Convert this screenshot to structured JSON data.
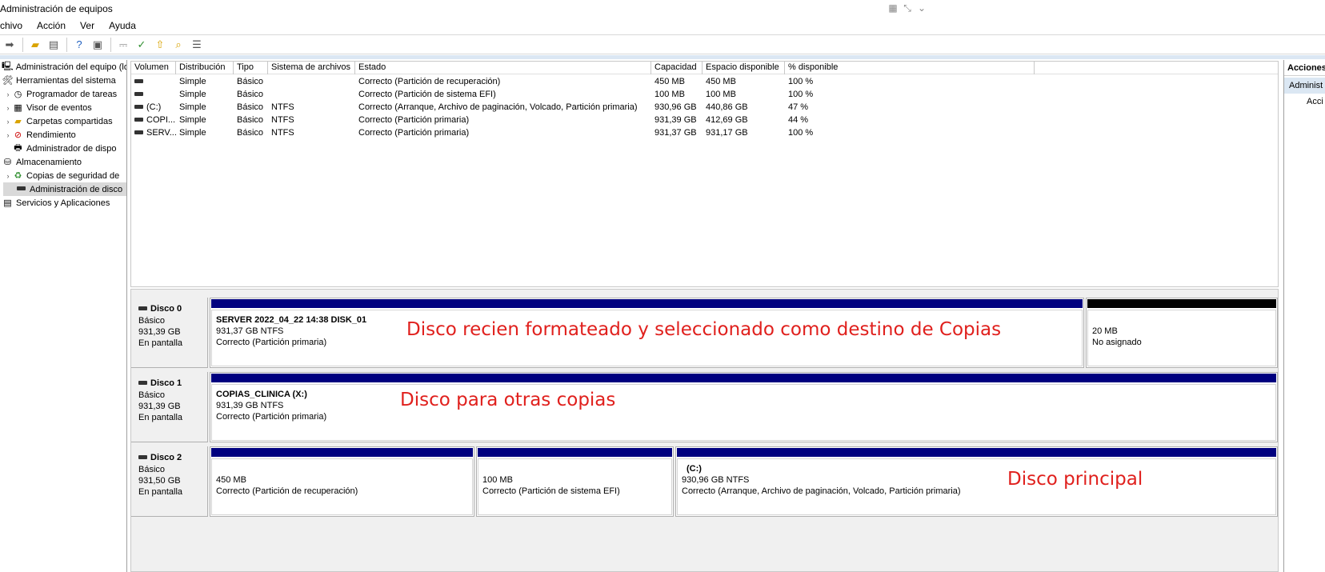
{
  "window": {
    "title": "Administración de equipos"
  },
  "menu": [
    "chivo",
    "Acción",
    "Ver",
    "Ayuda"
  ],
  "tree": [
    {
      "label": "Administración del equipo (loc",
      "level": 0,
      "icon": "computer-icon",
      "chevron": false
    },
    {
      "label": "Herramientas del sistema",
      "level": 0,
      "icon": "tools-icon",
      "chevron": false
    },
    {
      "label": "Programador de tareas",
      "level": 1,
      "icon": "clock-icon",
      "chevron": true
    },
    {
      "label": "Visor de eventos",
      "level": 1,
      "icon": "event-viewer-icon",
      "chevron": true
    },
    {
      "label": "Carpetas compartidas",
      "level": 1,
      "icon": "shared-folder-icon",
      "chevron": true
    },
    {
      "label": "Rendimiento",
      "level": 1,
      "icon": "performance-icon",
      "chevron": true
    },
    {
      "label": "Administrador de dispo",
      "level": 1,
      "icon": "device-manager-icon",
      "chevron": false
    },
    {
      "label": "Almacenamiento",
      "level": 0,
      "icon": "storage-icon",
      "chevron": false
    },
    {
      "label": "Copias de seguridad de",
      "level": 1,
      "icon": "backup-icon",
      "chevron": true
    },
    {
      "label": "Administración de disco",
      "level": 1,
      "icon": "disk-icon",
      "chevron": false,
      "selected": true
    },
    {
      "label": "Servicios y Aplicaciones",
      "level": 0,
      "icon": "services-icon",
      "chevron": false
    }
  ],
  "volumes": {
    "headers": [
      "Volumen",
      "Distribución",
      "Tipo",
      "Sistema de archivos",
      "Estado",
      "Capacidad",
      "Espacio disponible",
      "% disponible"
    ],
    "rows": [
      [
        "",
        "Simple",
        "Básico",
        "",
        "Correcto (Partición de recuperación)",
        "450 MB",
        "450 MB",
        "100 %"
      ],
      [
        "",
        "Simple",
        "Básico",
        "",
        "Correcto (Partición de sistema EFI)",
        "100 MB",
        "100 MB",
        "100 %"
      ],
      [
        "(C:)",
        "Simple",
        "Básico",
        "NTFS",
        "Correcto (Arranque, Archivo de paginación, Volcado, Partición primaria)",
        "930,96 GB",
        "440,86 GB",
        "47 %"
      ],
      [
        "COPI...",
        "Simple",
        "Básico",
        "NTFS",
        "Correcto (Partición primaria)",
        "931,39 GB",
        "412,69 GB",
        "44 %"
      ],
      [
        "SERV...",
        "Simple",
        "Básico",
        "NTFS",
        "Correcto (Partición primaria)",
        "931,37 GB",
        "931,17 GB",
        "100 %"
      ]
    ]
  },
  "disks": [
    {
      "name": "Disco 0",
      "type": "Básico",
      "size": "931,39 GB",
      "status": "En pantalla",
      "annotation": "Disco recien formateado y seleccionado como destino de Copias",
      "partitions": [
        {
          "title": "SERVER 2022_04_22 14:38 DISK_01",
          "size": "931,37 GB NTFS",
          "status": "Correcto (Partición primaria)",
          "bar": "blue"
        },
        {
          "title": "",
          "size": "20 MB",
          "status": "No asignado",
          "bar": "black"
        }
      ]
    },
    {
      "name": "Disco 1",
      "type": "Básico",
      "size": "931,39 GB",
      "status": "En pantalla",
      "annotation": "Disco para otras copias",
      "partitions": [
        {
          "title": "COPIAS_CLINICA  (X:)",
          "size": "931,39 GB NTFS",
          "status": "Correcto (Partición primaria)",
          "bar": "blue"
        }
      ]
    },
    {
      "name": "Disco 2",
      "type": "Básico",
      "size": "931,50 GB",
      "status": "En pantalla",
      "annotation": "Disco principal",
      "partitions": [
        {
          "title": "",
          "size": "450 MB",
          "status": "Correcto (Partición de recuperación)",
          "bar": "blue"
        },
        {
          "title": "",
          "size": "100 MB",
          "status": "Correcto (Partición de sistema EFI)",
          "bar": "blue"
        },
        {
          "title": "(C:)",
          "size": "930,96 GB NTFS",
          "status": "Correcto (Arranque, Archivo de paginación, Volcado, Partición primaria)",
          "bar": "blue"
        }
      ]
    }
  ],
  "actions": {
    "header": "Acciones",
    "selected": "Administ",
    "item": "Acci"
  },
  "colors": {
    "partition_bar": "#00007f",
    "unallocated_bar": "#000000",
    "annotation": "#e0201d",
    "selection": "#dbe7f3"
  }
}
